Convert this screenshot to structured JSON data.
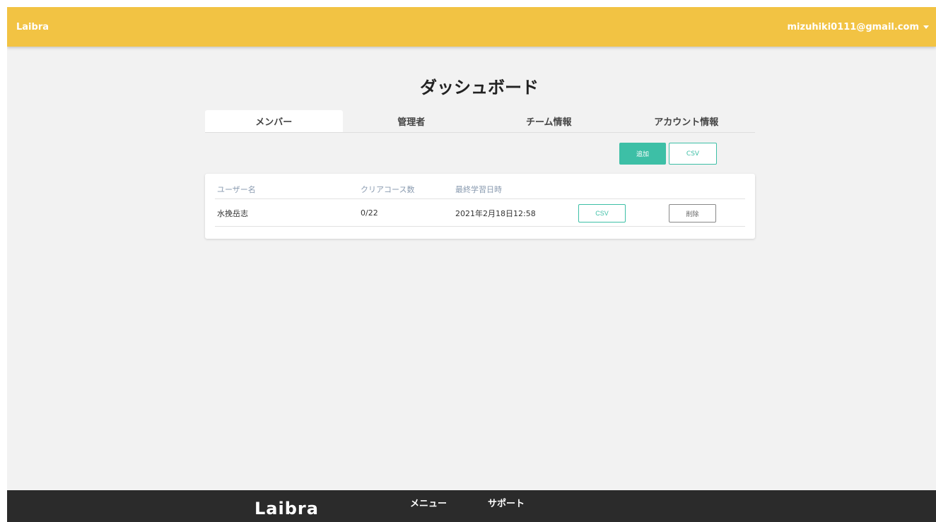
{
  "header": {
    "brand": "Laibra",
    "account_email": "mizuhiki0111@gmail.com"
  },
  "page": {
    "title": "ダッシュボード"
  },
  "tabs": [
    {
      "label": "メンバー",
      "active": true
    },
    {
      "label": "管理者",
      "active": false
    },
    {
      "label": "チーム情報",
      "active": false
    },
    {
      "label": "アカウント情報",
      "active": false
    }
  ],
  "actions": {
    "add_label": "追加",
    "csv_label": "CSV"
  },
  "table": {
    "columns": [
      "ユーザー名",
      "クリアコース数",
      "最終学習日時"
    ],
    "rows": [
      {
        "user_name": "水挽岳志",
        "cleared_courses": "0/22",
        "last_learned": "2021年2月18日12:58",
        "csv_label": "CSV",
        "delete_label": "削除"
      }
    ]
  },
  "footer": {
    "brand": "Laibra",
    "links": [
      "メニュー",
      "サポート"
    ]
  },
  "colors": {
    "header_bg": "#f2c343",
    "accent": "#3dbfa6",
    "footer_bg": "#2b2b2b",
    "page_bg": "#f2f2f2"
  }
}
